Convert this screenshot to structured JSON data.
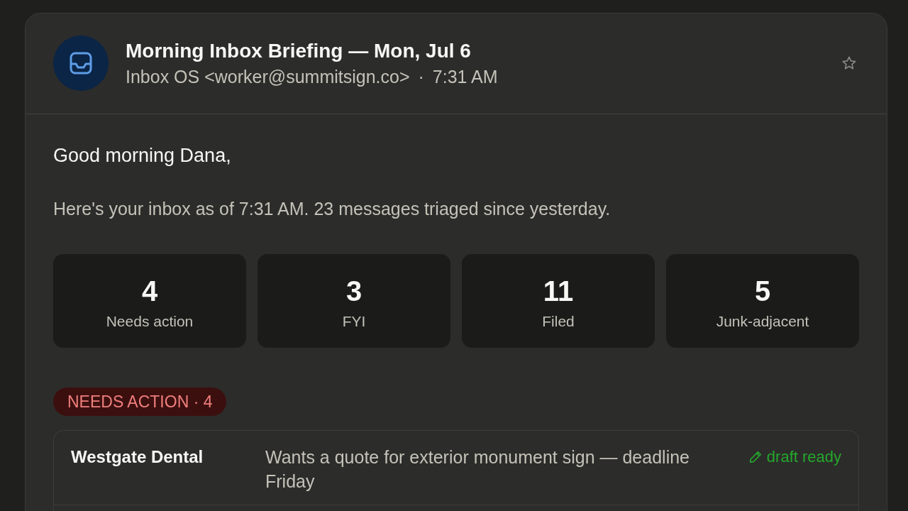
{
  "email": {
    "subject": "Morning Inbox Briefing — Mon, Jul 6",
    "sender": "Inbox OS <worker@summitsign.co>",
    "separator": "·",
    "time": "7:31 AM",
    "starred": false
  },
  "body": {
    "greeting": "Good morning Dana,",
    "intro": "Here's your inbox as of 7:31 AM. 23 messages triaged since yesterday.",
    "stats": [
      {
        "value": "4",
        "label": "Needs action"
      },
      {
        "value": "3",
        "label": "FYI"
      },
      {
        "value": "11",
        "label": "Filed"
      },
      {
        "value": "5",
        "label": "Junk-adjacent"
      }
    ],
    "sections": [
      {
        "kind": "needs_action",
        "label": "NEEDS ACTION · 4",
        "items": [
          {
            "sender": "Westgate Dental",
            "summary": "Wants a quote for exterior monument sign — deadline Friday",
            "status": {
              "kind": "draft",
              "label": "draft ready"
            }
          }
        ]
      }
    ]
  }
}
